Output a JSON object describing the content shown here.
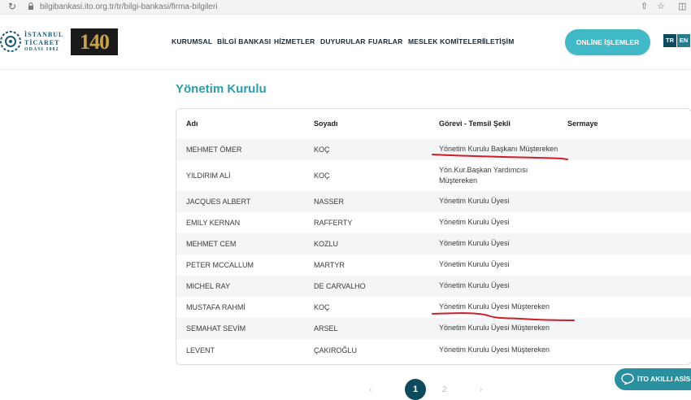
{
  "browser": {
    "url": "bilgibankasi.ito.org.tr/tr/bilgi-bankasi/firma-bilgileri",
    "reload_icon": "reload-icon",
    "share_icon": "share-icon",
    "star_icon": "star-icon",
    "sidebar_icon": "sidebar-icon"
  },
  "header": {
    "logo_line1": "İSTANBUL",
    "logo_line2": "TİCARET",
    "logo_line3": "ODASI 1882",
    "anniversary": "140",
    "nav": [
      "KURUMSAL",
      "BİLGİ BANKASI",
      "HİZMETLER",
      "DUYURULAR",
      "FUARLAR",
      "MESLEK KOMİTELERİ",
      "İLETİŞİM"
    ],
    "online_button": "ONLİNE İŞLEMLER",
    "lang_tr": "TR",
    "lang_en": "EN"
  },
  "section": {
    "title": "Yönetim Kurulu"
  },
  "table": {
    "columns": [
      "Adı",
      "Soyadı",
      "Görevi - Temsil Şekli",
      "Sermaye"
    ],
    "rows": [
      {
        "first": "MEHMET ÖMER",
        "last": "KOÇ",
        "position": "Yönetim Kurulu Başkanı Müştereken",
        "capital": ""
      },
      {
        "first": "YILDIRIM ALİ",
        "last": "KOÇ",
        "position": "Yön.Kur.Başkan Yardımcısı",
        "position2": "Müştereken",
        "capital": ""
      },
      {
        "first": "JACQUES ALBERT",
        "last": "NASSER",
        "position": "Yönetim Kurulu Üyesi",
        "capital": ""
      },
      {
        "first": "EMILY KERNAN",
        "last": "RAFFERTY",
        "position": "Yönetim Kurulu Üyesi",
        "capital": ""
      },
      {
        "first": "MEHMET CEM",
        "last": "KOZLU",
        "position": "Yönetim Kurulu Üyesi",
        "capital": ""
      },
      {
        "first": "PETER MCCALLUM",
        "last": "MARTYR",
        "position": "Yönetim Kurulu Üyesi",
        "capital": ""
      },
      {
        "first": "MICHEL RAY",
        "last": "DE CARVALHO",
        "position": "Yönetim Kurulu Üyesi",
        "capital": ""
      },
      {
        "first": "MUSTAFA RAHMİ",
        "last": "KOÇ",
        "position": "Yönetim Kurulu Üyesi Müştereken",
        "capital": ""
      },
      {
        "first": "SEMAHAT SEVİM",
        "last": "ARSEL",
        "position": "Yönetim Kurulu Üyesi Müştereken",
        "capital": ""
      },
      {
        "first": "LEVENT",
        "last": "ÇAKIROĞLU",
        "position": "Yönetim Kurulu Üyesi Müştereken",
        "capital": ""
      }
    ]
  },
  "pagination": {
    "current": "1",
    "next": "2"
  },
  "assistant": {
    "label": "İTO AKILLI ASİS",
    "icon": "chat-bubble-icon"
  },
  "colors": {
    "accent": "#2d9cab",
    "dark": "#0e4a5c",
    "annotation": "#cc1f2a"
  }
}
